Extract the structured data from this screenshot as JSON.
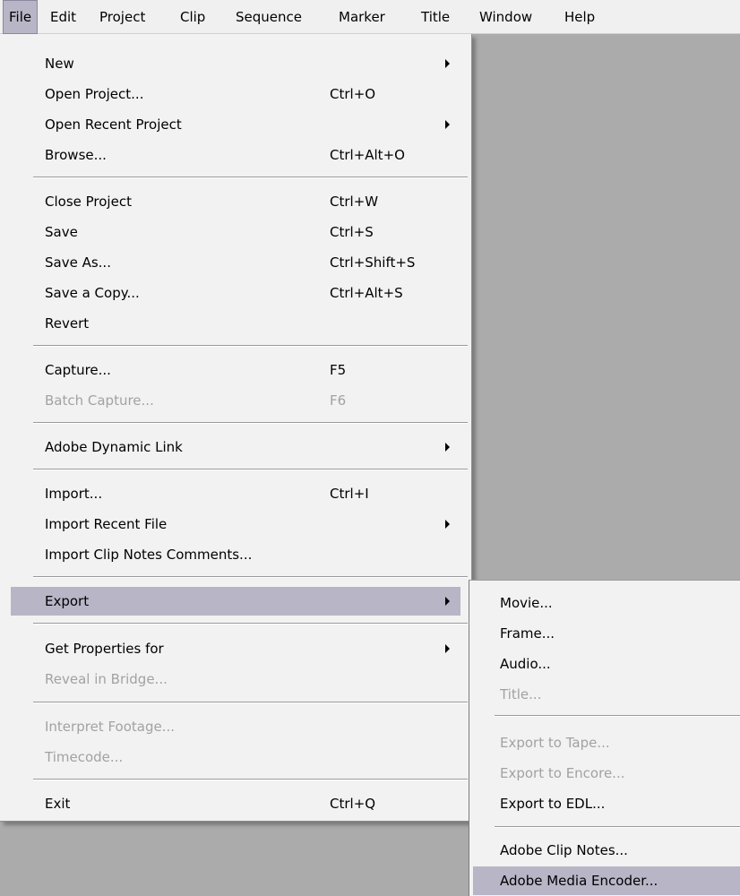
{
  "menubar": {
    "items": [
      {
        "label": "File"
      },
      {
        "label": "Edit"
      },
      {
        "label": "Project"
      },
      {
        "label": "Clip"
      },
      {
        "label": "Sequence"
      },
      {
        "label": "Marker"
      },
      {
        "label": "Title"
      },
      {
        "label": "Window"
      },
      {
        "label": "Help"
      }
    ]
  },
  "file_menu": {
    "items": [
      {
        "label": "New"
      },
      {
        "label": "Open Project...",
        "shortcut": "Ctrl+O"
      },
      {
        "label": "Open Recent Project"
      },
      {
        "label": "Browse...",
        "shortcut": "Ctrl+Alt+O"
      },
      {
        "label": "Close Project",
        "shortcut": "Ctrl+W"
      },
      {
        "label": "Save",
        "shortcut": "Ctrl+S"
      },
      {
        "label": "Save As...",
        "shortcut": "Ctrl+Shift+S"
      },
      {
        "label": "Save a Copy...",
        "shortcut": "Ctrl+Alt+S"
      },
      {
        "label": "Revert"
      },
      {
        "label": "Capture...",
        "shortcut": "F5"
      },
      {
        "label": "Batch Capture...",
        "shortcut": "F6"
      },
      {
        "label": "Adobe Dynamic Link"
      },
      {
        "label": "Import...",
        "shortcut": "Ctrl+I"
      },
      {
        "label": "Import Recent File"
      },
      {
        "label": "Import Clip Notes Comments..."
      },
      {
        "label": "Export"
      },
      {
        "label": "Get Properties for"
      },
      {
        "label": "Reveal in Bridge..."
      },
      {
        "label": "Interpret Footage..."
      },
      {
        "label": "Timecode..."
      },
      {
        "label": "Exit",
        "shortcut": "Ctrl+Q"
      }
    ]
  },
  "export_menu": {
    "items": [
      {
        "label": "Movie..."
      },
      {
        "label": "Frame..."
      },
      {
        "label": "Audio..."
      },
      {
        "label": "Title..."
      },
      {
        "label": "Export to Tape..."
      },
      {
        "label": "Export to Encore..."
      },
      {
        "label": "Export to EDL..."
      },
      {
        "label": "Adobe Clip Notes..."
      },
      {
        "label": "Adobe Media Encoder..."
      }
    ]
  },
  "colors": {
    "menu_background": "#f2f2f2",
    "workspace_background": "#ababab",
    "highlight": "#b7b5c6",
    "disabled_text": "#a2a2a2"
  }
}
